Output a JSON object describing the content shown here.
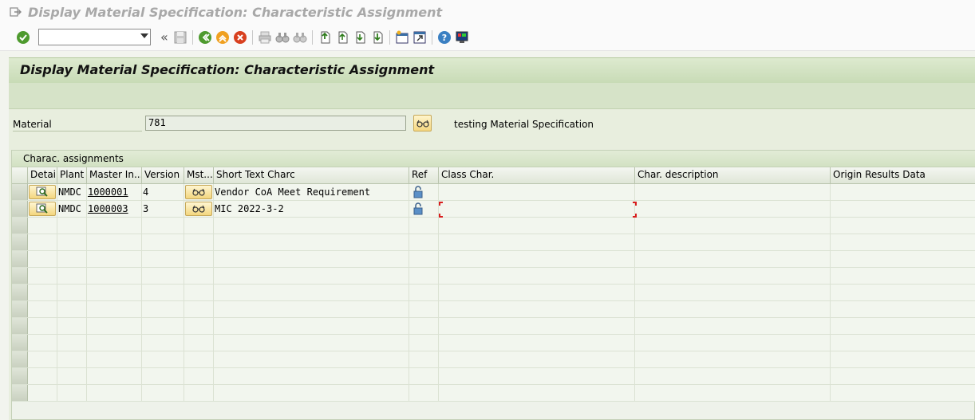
{
  "window": {
    "title": "Display Material Specification: Characteristic Assignment"
  },
  "toolbar": {
    "command_field_value": "",
    "icons": [
      "enter-check-icon",
      "save-icon",
      "back-icon",
      "exit-icon",
      "cancel-icon",
      "print-icon",
      "find-icon",
      "find-next-icon",
      "first-page-icon",
      "previous-page-icon",
      "next-page-icon",
      "last-page-icon",
      "create-session-icon",
      "shortcut-icon",
      "help-icon",
      "customize-layout-icon"
    ],
    "collapse_symbol": "«"
  },
  "screen": {
    "header_title": "Display Material Specification: Characteristic Assignment"
  },
  "material": {
    "label": "Material",
    "value": "781",
    "description": "testing Material Specification"
  },
  "table": {
    "caption": "Charac. assignments",
    "columns": [
      "Detail",
      "Plant",
      "Master In...",
      "Version",
      "Mst...",
      "Short Text Charc",
      "Ref",
      "Class Char.",
      "Char. description",
      "Origin Results Data"
    ],
    "rows": [
      {
        "plant": "NMDC",
        "master_insp": "1000001",
        "version": "4",
        "short_text": "Vendor CoA Meet Requirement"
      },
      {
        "plant": "NMDC",
        "master_insp": "1000003",
        "version": "3",
        "short_text": "MIC 2022-3-2"
      }
    ],
    "empty_row_count": 11
  },
  "colors": {
    "accent_green": "#c8dbb6",
    "button_yellow": "#f3d67e",
    "focus_red": "#d81e1e"
  }
}
